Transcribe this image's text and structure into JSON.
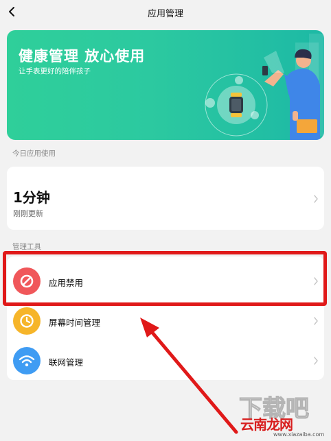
{
  "nav": {
    "title": "应用管理",
    "back_icon": "chevron-left-icon"
  },
  "banner": {
    "title": "健康管理 放心使用",
    "subtitle": "让手表更好的陪伴孩子",
    "colors": {
      "start": "#2fcf9a",
      "end": "#1db9a5"
    }
  },
  "usage_section": {
    "label": "今日应用使用",
    "value": "1分钟",
    "updated": "刚刚更新"
  },
  "tools_section": {
    "label": "管理工具",
    "items": [
      {
        "label": "应用禁用",
        "icon": "prohibited-icon",
        "color": "#f0575a"
      },
      {
        "label": "屏幕时间管理",
        "icon": "clock-icon",
        "color": "#f6b52a"
      },
      {
        "label": "联网管理",
        "icon": "wifi-icon",
        "color": "#3f9cf3"
      }
    ]
  },
  "annotation": {
    "highlight_color": "#e01919"
  },
  "watermark": {
    "text": "云南龙网",
    "url": "www.xiazaiba.com"
  }
}
